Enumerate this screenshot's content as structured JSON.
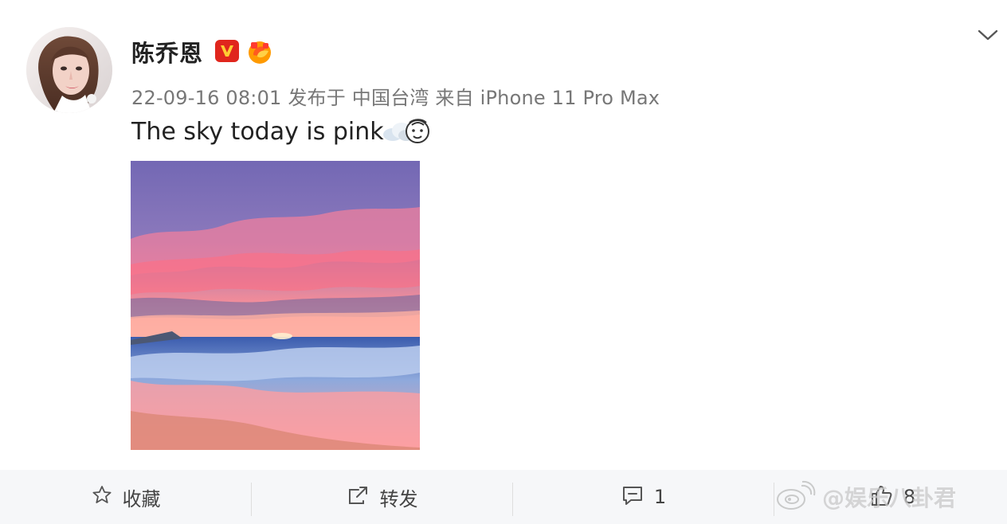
{
  "post": {
    "author": "陈乔恩",
    "meta": "22-09-16 08:01 发布于 中国台湾 来自 iPhone 11 Pro Max",
    "text": "The sky today is pink"
  },
  "actions": [
    {
      "icon": "star-icon",
      "label": "收藏"
    },
    {
      "icon": "share-icon",
      "label": "转发"
    },
    {
      "icon": "comment-icon",
      "label": "1"
    },
    {
      "icon": "like-icon",
      "label": "8"
    }
  ],
  "watermark": {
    "text": "@娱乐八卦君"
  },
  "colors": {
    "verified": "#e0261d",
    "badge": "#ff9a00",
    "meta_text": "#777777",
    "action_bar": "#f6f7f9"
  }
}
